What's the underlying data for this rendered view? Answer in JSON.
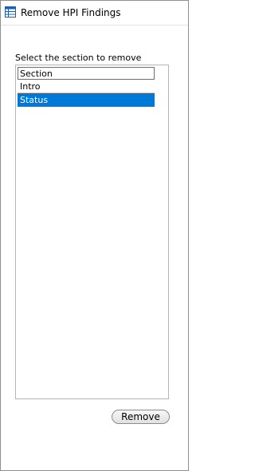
{
  "window": {
    "title": "Remove HPI Findings",
    "icon": "table-icon"
  },
  "form": {
    "prompt": "Select the section to remove"
  },
  "sections_list": {
    "column_header": "Section",
    "rows": [
      {
        "label": "Intro",
        "selected": false
      },
      {
        "label": "Status",
        "selected": true
      }
    ],
    "selection_color": "#0078d7"
  },
  "actions": {
    "remove_label": "Remove"
  }
}
